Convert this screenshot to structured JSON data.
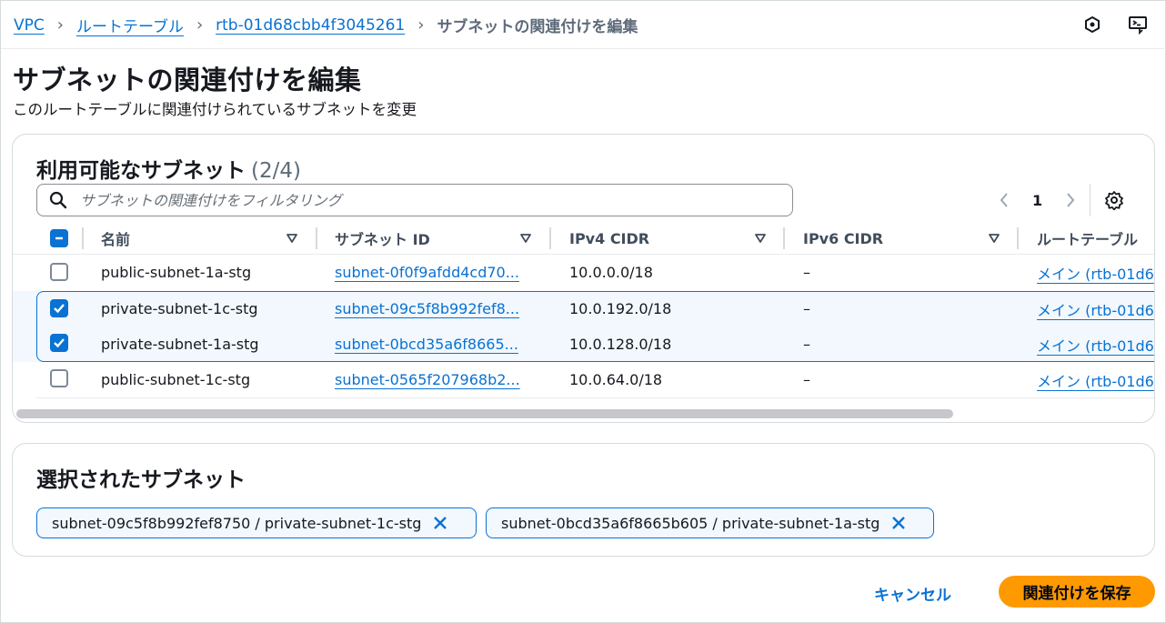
{
  "breadcrumb": {
    "items": [
      {
        "label": "VPC"
      },
      {
        "label": "ルートテーブル"
      },
      {
        "label": "rtb-01d68cbb4f3045261"
      }
    ],
    "current": "サブネットの関連付けを編集"
  },
  "header": {
    "title": "サブネットの関連付けを編集",
    "description": "このルートテーブルに関連付けられているサブネットを変更"
  },
  "available": {
    "title": "利用可能なサブネット",
    "count": "(2/4)",
    "search_placeholder": "サブネットの関連付けをフィルタリング",
    "search_value": "",
    "page": "1",
    "columns": [
      "名前",
      "サブネット ID",
      "IPv4 CIDR",
      "IPv6 CIDR",
      "ルートテーブル"
    ],
    "rows": [
      {
        "checked": false,
        "name": "public-subnet-1a-stg",
        "subnet_id": "subnet-0f0f9afdd4cd70...",
        "ipv4": "10.0.0.0/18",
        "ipv6": "–",
        "route_table": "メイン (rtb-01d6"
      },
      {
        "checked": true,
        "name": "private-subnet-1c-stg",
        "subnet_id": "subnet-09c5f8b992fef8...",
        "ipv4": "10.0.192.0/18",
        "ipv6": "–",
        "route_table": "メイン (rtb-01d6"
      },
      {
        "checked": true,
        "name": "private-subnet-1a-stg",
        "subnet_id": "subnet-0bcd35a6f8665...",
        "ipv4": "10.0.128.0/18",
        "ipv6": "–",
        "route_table": "メイン (rtb-01d6"
      },
      {
        "checked": false,
        "name": "public-subnet-1c-stg",
        "subnet_id": "subnet-0565f207968b2...",
        "ipv4": "10.0.64.0/18",
        "ipv6": "–",
        "route_table": "メイン (rtb-01d6"
      }
    ]
  },
  "selected": {
    "title": "選択されたサブネット",
    "tokens": [
      {
        "label": "subnet-09c5f8b992fef8750 / private-subnet-1c-stg"
      },
      {
        "label": "subnet-0bcd35a6f8665b605 / private-subnet-1a-stg"
      }
    ]
  },
  "footer": {
    "cancel_label": "キャンセル",
    "save_label": "関連付けを保存"
  },
  "colors": {
    "link": "#0972d3",
    "primary_button": "#ff9900",
    "selected_row_bg": "#f2f8fd"
  },
  "icons": [
    "cloudshell-hex-icon",
    "feedback-icon",
    "search-icon",
    "chevron-left-icon",
    "chevron-right-icon",
    "gear-icon",
    "sort-caret-icon",
    "close-icon",
    "check-icon"
  ]
}
